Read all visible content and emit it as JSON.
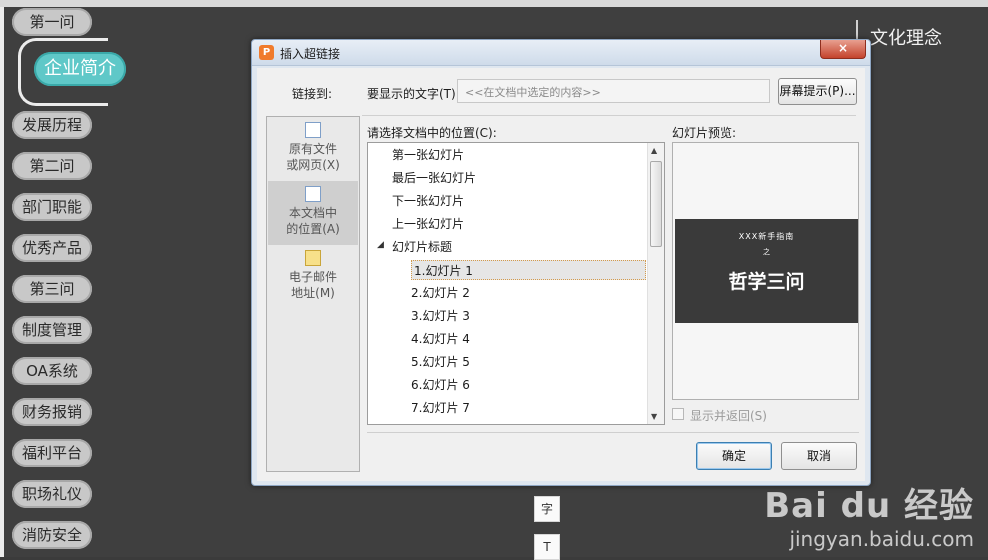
{
  "slide": {
    "title": "文化理念"
  },
  "sidebar": {
    "items": [
      {
        "label": "第一问"
      },
      {
        "label": "企业简介"
      },
      {
        "label": "发展历程"
      },
      {
        "label": "第二问"
      },
      {
        "label": "部门职能"
      },
      {
        "label": "优秀产品"
      },
      {
        "label": "第三问"
      },
      {
        "label": "制度管理"
      },
      {
        "label": "OA系统"
      },
      {
        "label": "财务报销"
      },
      {
        "label": "福利平台"
      },
      {
        "label": "职场礼仪"
      },
      {
        "label": "消防安全"
      }
    ],
    "active_index": 1
  },
  "toolbar_icons": {
    "char_icon": "字",
    "textbox_icon": "T"
  },
  "watermark": {
    "logo": "Bai du 经验",
    "url": "jingyan.baidu.com"
  },
  "dialog": {
    "app_icon": "P",
    "title": "插入超链接",
    "close": "×",
    "link_to_label": "链接到:",
    "display_text_label": "要显示的文字(T):",
    "display_text_placeholder": "<<在文档中选定的内容>>",
    "screen_tip_button": "屏幕提示(P)...",
    "location_label": "请选择文档中的位置(C):",
    "preview_label": "幻灯片预览:",
    "link_targets": [
      {
        "line1": "原有文件",
        "line2": "或网页(X)"
      },
      {
        "line1": "本文档中",
        "line2": "的位置(A)"
      },
      {
        "line1": "电子邮件",
        "line2": "地址(M)"
      }
    ],
    "link_target_selected": 1,
    "tree": {
      "top_items": [
        "第一张幻灯片",
        "最后一张幻灯片",
        "下一张幻灯片",
        "上一张幻灯片"
      ],
      "group_label": "幻灯片标题",
      "expander": "◢",
      "slides": [
        "1.幻灯片 1",
        "2.幻灯片 2",
        "3.幻灯片 3",
        "4.幻灯片 4",
        "5.幻灯片 5",
        "6.幻灯片 6",
        "7.幻灯片 7"
      ],
      "selected_slide": 0
    },
    "preview": {
      "subtitle": "XXX新手指南",
      "connector": "之",
      "main_title": "哲学三问"
    },
    "show_and_return_label": "显示并返回(S)",
    "show_and_return_checked": false,
    "ok_button": "确定",
    "cancel_button": "取消"
  }
}
